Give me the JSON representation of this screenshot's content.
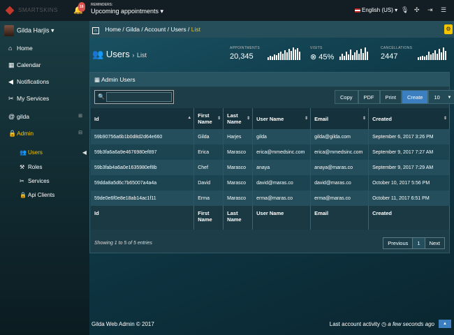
{
  "topbar": {
    "logo_text": "SMARTSKINS",
    "bell_count": "16",
    "reminders_label": "REMINDERS:",
    "reminders_value": "Upcoming appointments ▾",
    "language": "English (US) ▾",
    "icons": [
      "microphone-icon",
      "grid-icon",
      "logout-icon",
      "menu-icon"
    ]
  },
  "sidebar": {
    "user_name": "Gilda Harjis ▾",
    "nav": [
      {
        "label": "Home",
        "icon": "home-icon",
        "glyph": "⌂"
      },
      {
        "label": "Calendar",
        "icon": "calendar-icon",
        "glyph": "▦"
      },
      {
        "label": "Notifications",
        "icon": "megaphone-icon",
        "glyph": "◀"
      },
      {
        "label": "My Services",
        "icon": "scissors-icon",
        "glyph": "✂"
      },
      {
        "label": "gilda",
        "icon": "at-icon",
        "glyph": "@"
      },
      {
        "label": "Admin",
        "icon": "lock-icon",
        "glyph": "🔒"
      }
    ],
    "sub": [
      {
        "label": "Users",
        "icon": "users-icon",
        "glyph": "👥"
      },
      {
        "label": "Roles",
        "icon": "gavel-icon",
        "glyph": "⚒"
      },
      {
        "label": "Services",
        "icon": "scissors-icon",
        "glyph": "✂"
      },
      {
        "label": "Api Clients",
        "icon": "lock-icon",
        "glyph": "🔒"
      }
    ]
  },
  "breadcrumb": {
    "items": [
      "Home /",
      "Gilda /",
      "Account /",
      "Users /"
    ],
    "current": "List"
  },
  "page": {
    "title": "Users",
    "subtitle": "List"
  },
  "stats": [
    {
      "label": "APPOINTMENTS",
      "value": "20,345",
      "icon": ""
    },
    {
      "label": "VISITS",
      "value": "45%",
      "icon": "⊗"
    },
    {
      "label": "CANCELLATIONS",
      "value": "2447",
      "icon": ""
    }
  ],
  "panel": {
    "title": "Admin Users",
    "buttons": [
      "Copy",
      "PDF",
      "Print",
      "Create"
    ],
    "page_size": "10"
  },
  "table": {
    "headers": [
      "Id",
      "First Name",
      "Last Name",
      "User Name",
      "Email",
      "Created"
    ],
    "rows": [
      [
        "59b90756a6b1b0d8d2d64e660",
        "Gilda",
        "Harjes",
        "gilda",
        "gilda@gilda.com",
        "September 6, 2017 3:26 PM"
      ],
      [
        "59b3fa6a6a9e4676980ef897",
        "Erica",
        "Marasco",
        "erica@mmedsinc.com",
        "erica@mmedsinc.com",
        "September 9, 2017 7:27 AM"
      ],
      [
        "59b3fab4a6a0e1635980ef8b",
        "Chef",
        "Marasco",
        "anaya",
        "anaya@maras.co",
        "September 9, 2017 7:29 AM"
      ],
      [
        "59dda8a5d6c7b65007a4a4a",
        "David",
        "Marasco",
        "david@maras.co",
        "david@maras.co",
        "October 10, 2017 5:56 PM"
      ],
      [
        "59de0e6f0e8e18ab14ac1f11",
        "Erma",
        "Marasco",
        "erma@maras.co",
        "erma@maras.co",
        "October 11, 2017 6:51 PM"
      ]
    ],
    "footer": [
      "Id",
      "First Name",
      "Last Name",
      "User Name",
      "Email",
      "Created"
    ]
  },
  "info": "Showing 1 to 5 of 5 entries",
  "pager": {
    "prev": "Previous",
    "page": "1",
    "next": "Next"
  },
  "footer": {
    "left": "Gilda Web Admin © 2017",
    "right_prefix": "Last account activity",
    "right_time": "a few seconds ago"
  }
}
